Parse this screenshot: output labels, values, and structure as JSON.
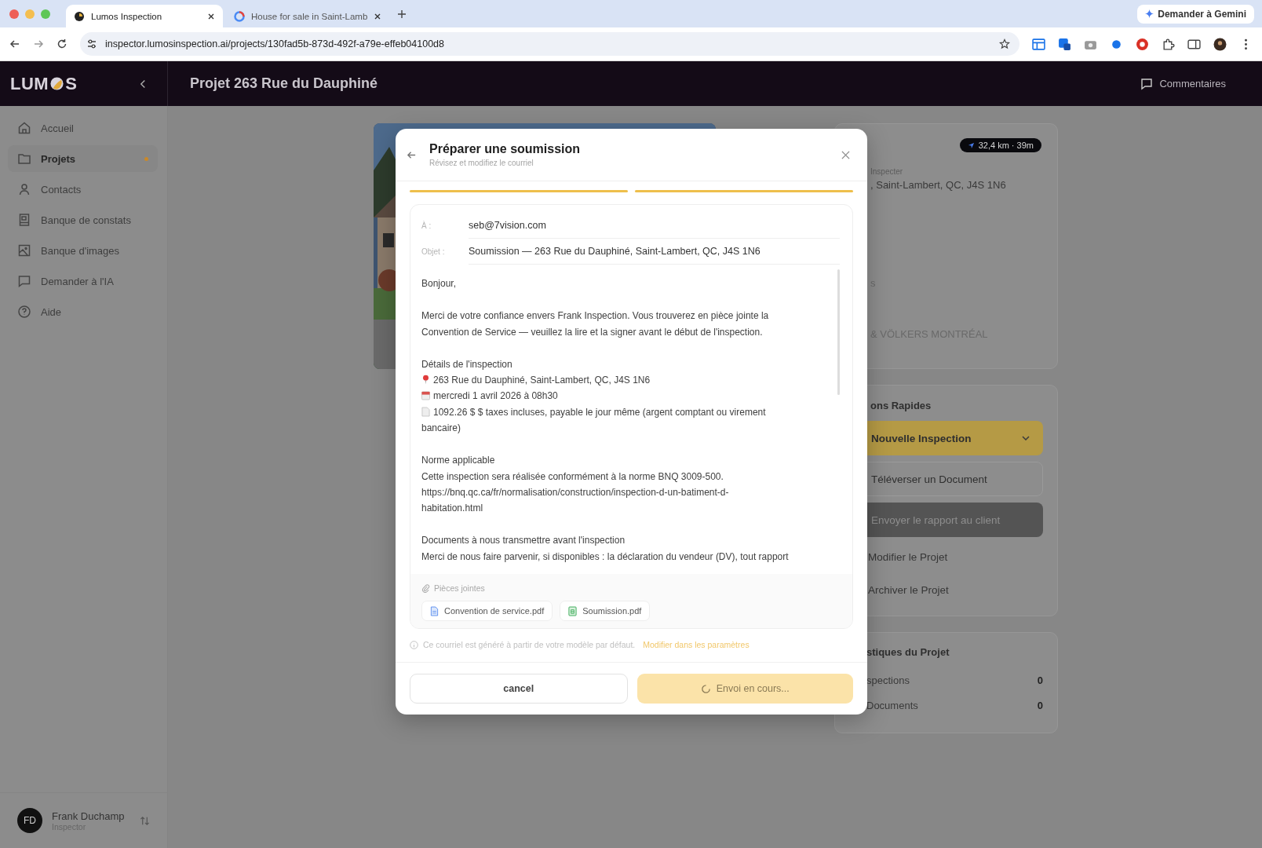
{
  "browser": {
    "tabs": [
      {
        "title": "Lumos Inspection",
        "selected": true
      },
      {
        "title": "House for sale in Saint-Lamb",
        "selected": false
      }
    ],
    "address": "inspector.lumosinspection.ai/projects/130fad5b-873d-492f-a79e-effeb04100d8",
    "gemini": "Demander à Gemini"
  },
  "app": {
    "logo_start": "LUM",
    "logo_end": "S",
    "title": "Projet 263 Rue du Dauphiné",
    "comments": "Commentaires"
  },
  "sidebar": {
    "items": [
      {
        "label": "Accueil",
        "selected": false
      },
      {
        "label": "Projets",
        "selected": true
      },
      {
        "label": "Contacts",
        "selected": false
      },
      {
        "label": "Banque de constats",
        "selected": false
      },
      {
        "label": "Banque d'images",
        "selected": false
      },
      {
        "label": "Demander à l'IA",
        "selected": false
      },
      {
        "label": "Aide",
        "selected": false
      }
    ],
    "user": {
      "initials": "FD",
      "name": "Frank Duchamp",
      "role": "Inspector"
    }
  },
  "project": {
    "distance": "32,4 km · 39m",
    "caption": "Inspecter",
    "address": ", Saint-Lambert, QC, J4S 1N6",
    "fragment": "s",
    "agency": "& VÖLKERS MONTRÉAL"
  },
  "actions": {
    "title": "ons Rapides",
    "buttons": [
      {
        "label": "Nouvelle Inspection",
        "kind": "primary"
      },
      {
        "label": "Téléverser un Document",
        "kind": "outline"
      },
      {
        "label": "Envoyer le rapport au client",
        "kind": "dark"
      },
      {
        "label": "Modifier le Projet",
        "kind": "plain"
      },
      {
        "label": "Archiver le Projet",
        "kind": "plain"
      }
    ]
  },
  "stats": {
    "title": "stiques du Projet",
    "rows": [
      {
        "label": "spections",
        "value": "0"
      },
      {
        "label": "Documents",
        "value": "0"
      }
    ]
  },
  "modal": {
    "title": "Préparer une soumission",
    "subtitle": "Révisez et modifiez le courriel",
    "steps": [
      {
        "completed": true
      },
      {
        "completed": true
      }
    ],
    "to_label": "À :",
    "to": "seb@7vision.com",
    "subject_label": "Objet :",
    "subject": "Soumission — 263 Rue du Dauphiné, Saint-Lambert, QC, J4S 1N6",
    "body": [
      [
        {
          "kind": "text",
          "text": "Bonjour,"
        }
      ],
      [
        {
          "kind": "text",
          "text": "Merci de votre confiance envers Frank Inspection. Vous trouverez en pièce jointe la\nConvention de Service — veuillez la lire et la signer avant le début de l'inspection."
        }
      ],
      [
        {
          "kind": "text",
          "text": "Détails de l'inspection"
        },
        {
          "kind": "location",
          "text": "263 Rue du Dauphiné, Saint-Lambert, QC, J4S 1N6"
        },
        {
          "kind": "date",
          "text": "mercredi 1 avril 2026 à 08h30"
        },
        {
          "kind": "price",
          "text": "1092.26 $ $ taxes incluses, payable le jour même (argent comptant ou virement"
        },
        {
          "kind": "text",
          "text": "bancaire)"
        }
      ],
      [
        {
          "kind": "text",
          "text": "Norme applicable"
        },
        {
          "kind": "text",
          "text": "Cette inspection sera réalisée conformément à la norme BNQ 3009-500."
        },
        {
          "kind": "text",
          "text": "https://bnq.qc.ca/fr/normalisation/construction/inspection-d-un-batiment-d-\nhabitation.html"
        }
      ],
      [
        {
          "kind": "text",
          "text": "Documents à nous transmettre avant l'inspection"
        },
        {
          "kind": "text",
          "text": "Merci de nous faire parvenir, si disponibles : la déclaration du vendeur (DV), tout rapport"
        }
      ]
    ],
    "attachments_label": "Pièces jointes",
    "attachments": [
      {
        "name": "Convention de service.pdf",
        "kind": "document"
      },
      {
        "name": "Soumission.pdf",
        "kind": "sheet"
      }
    ],
    "note": "Ce courriel est généré à partir de votre modèle par défaut.",
    "note_link": "Modifier dans les paramètres",
    "cancel": "cancel",
    "send": "Envoi en cours...",
    "sending": true
  }
}
